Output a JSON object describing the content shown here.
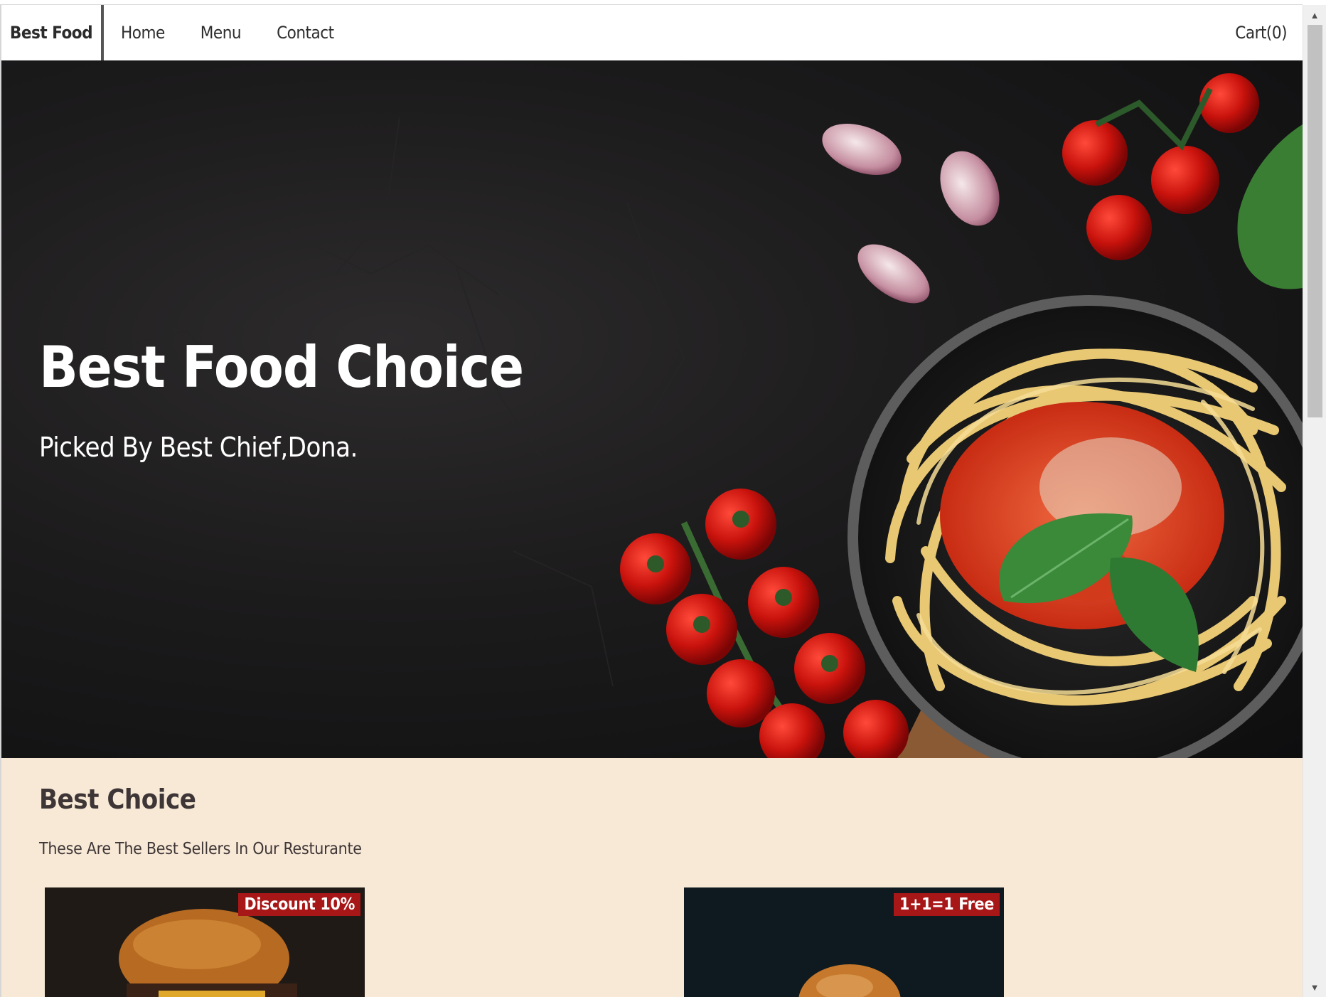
{
  "navbar": {
    "brand": "Best Food",
    "links": [
      "Home",
      "Menu",
      "Contact"
    ],
    "cart": "Cart(0)"
  },
  "hero": {
    "title": "Best Food Choice",
    "subtitle": "Picked By Best Chief,Dona."
  },
  "best_choice": {
    "title": "Best Choice",
    "subtitle": "These Are The Best Sellers In Our Resturante",
    "cards": [
      {
        "badge": "Discount 10%",
        "image": "burger-photo"
      },
      {
        "badge": "1+1=1 Free",
        "image": "burger-photo"
      }
    ]
  },
  "colors": {
    "hero_bg": "#1c1b1c",
    "section_bg": "#f8e9d7",
    "badge_bg": "#a81717",
    "text_dark": "#3e3636"
  }
}
